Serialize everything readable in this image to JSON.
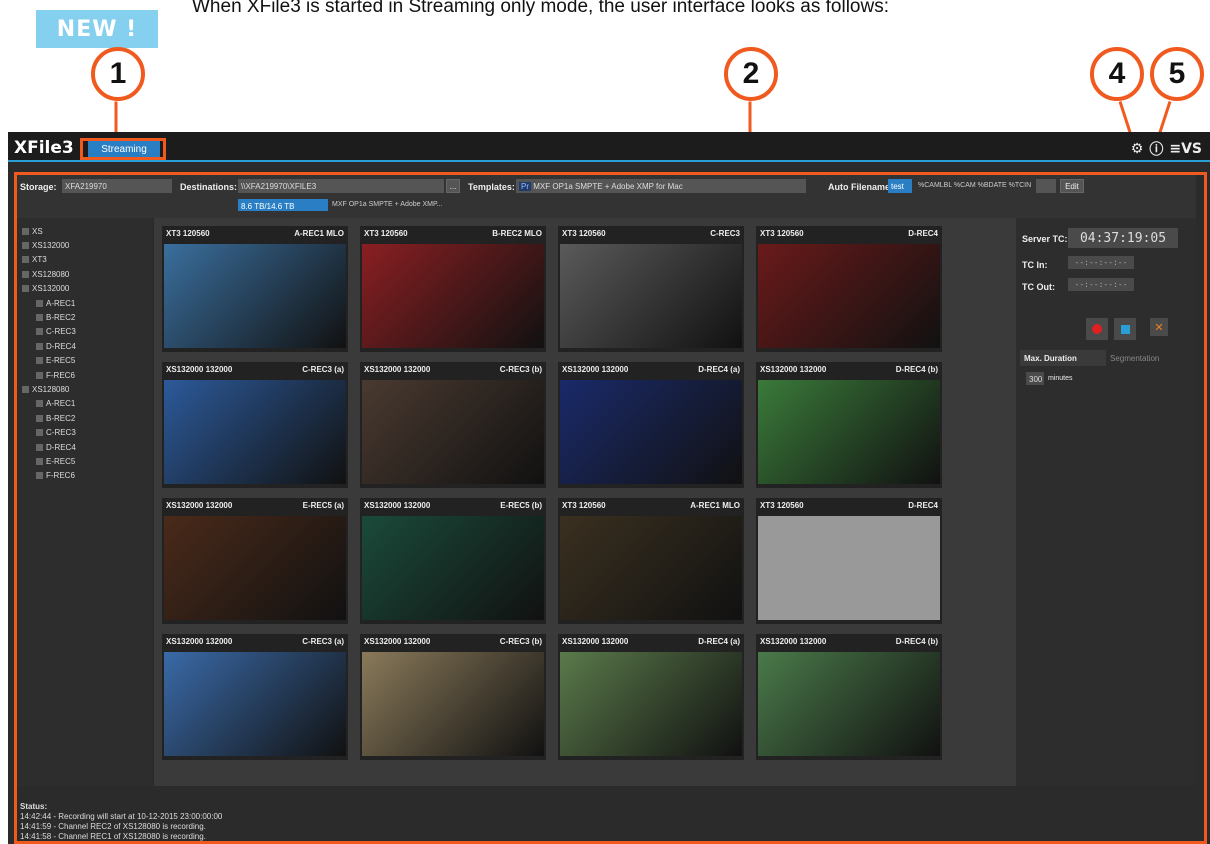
{
  "badge": "NEW !",
  "intro": "When XFile3 is started in Streaming only mode, the user interface looks as follows:",
  "callouts": [
    "1",
    "2",
    "4",
    "5"
  ],
  "app": {
    "logo": "XFile3",
    "tab": "Streaming",
    "right_icons": [
      "gear-icon",
      "help-icon"
    ],
    "brand": "≡VS"
  },
  "toolbar": {
    "storage_label": "Storage:",
    "storage_value": "XFA219970",
    "dest_label": "Destinations:",
    "dest_value": "\\\\XFA219970\\XFILE3",
    "dest_btn": "...",
    "space": "8.6 TB/14.6 TB",
    "space_tpl": "MXF OP1a SMPTE + Adobe XMP...",
    "tpl_label": "Templates:",
    "tpl_badge": "Pr",
    "tpl_value": "MXF OP1a SMPTE + Adobe XMP for Mac",
    "auto_label": "Auto Filename:",
    "auto_test": "test",
    "auto_pattern": "%CAMLBL %CAM %BDATE %TCIN",
    "edit": "Edit"
  },
  "tree": [
    "XS",
    "XS132000",
    "XT3",
    "XS128080",
    "XS132000",
    "A-REC1",
    "B-REC2",
    "C-REC3",
    "D-REC4",
    "E-REC5",
    "F-REC6",
    "XS128080",
    "A-REC1",
    "B-REC2",
    "C-REC3",
    "D-REC4",
    "E-REC5",
    "F-REC6"
  ],
  "tiles": [
    {
      "l": "XT3    120560",
      "r": "A-REC1 MLO"
    },
    {
      "l": "XT3    120560",
      "r": "B-REC2 MLO"
    },
    {
      "l": "XT3    120560",
      "r": "C-REC3"
    },
    {
      "l": "XT3    120560",
      "r": "D-REC4"
    },
    {
      "l": "XS132000 132000",
      "r": "C-REC3 (a)"
    },
    {
      "l": "XS132000 132000",
      "r": "C-REC3 (b)"
    },
    {
      "l": "XS132000 132000",
      "r": "D-REC4 (a)"
    },
    {
      "l": "XS132000 132000",
      "r": "D-REC4 (b)"
    },
    {
      "l": "XS132000 132000",
      "r": "E-REC5 (a)"
    },
    {
      "l": "XS132000 132000",
      "r": "E-REC5 (b)"
    },
    {
      "l": "XT3    120560",
      "r": "A-REC1 MLO"
    },
    {
      "l": "XT3    120560",
      "r": "D-REC4"
    },
    {
      "l": "XS132000 132000",
      "r": "C-REC3 (a)"
    },
    {
      "l": "XS132000 132000",
      "r": "C-REC3 (b)"
    },
    {
      "l": "XS132000 132000",
      "r": "D-REC4 (a)"
    },
    {
      "l": "XS132000 132000",
      "r": "D-REC4 (b)"
    }
  ],
  "right": {
    "server_tc_label": "Server TC:",
    "server_tc": "04:37:19:05",
    "tc_in_label": "TC In:",
    "tc_out_label": "TC Out:",
    "tc_blank": "--:--:--:--",
    "tab_max": "Max. Duration",
    "tab_seg": "Segmentation",
    "duration": "300",
    "minutes": "minutes"
  },
  "status": {
    "title": "Status:",
    "lines": [
      "14:42:44 - Recording will start at 10-12-2015 23:00:00:00",
      "14:41:59 - Channel REC2 of XS128080 is recording.",
      "14:41:58 - Channel REC1 of XS128080 is recording."
    ]
  }
}
